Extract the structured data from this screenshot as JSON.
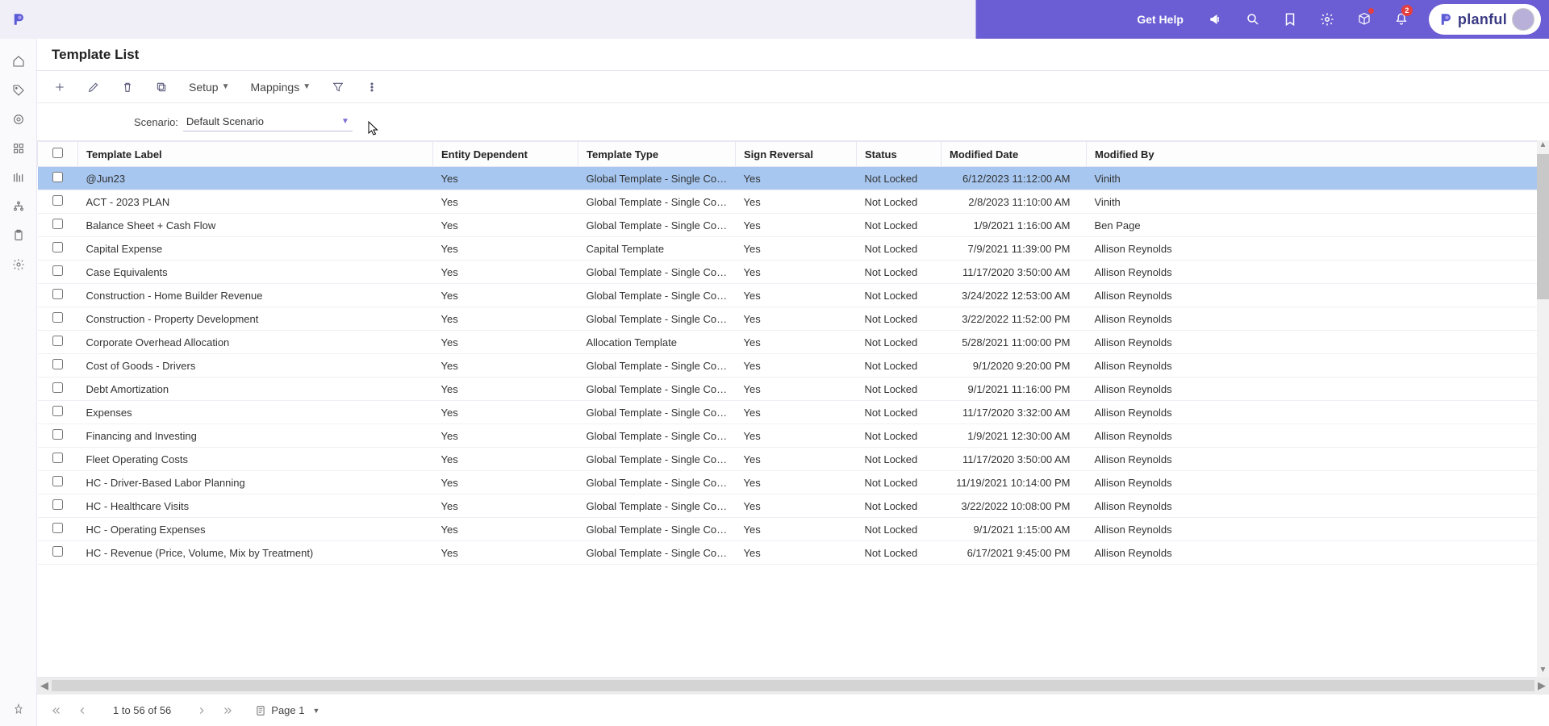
{
  "brand": {
    "name": "planful"
  },
  "header": {
    "get_help": "Get Help",
    "notification_count": "2"
  },
  "page": {
    "title": "Template List"
  },
  "toolbar": {
    "setup": "Setup",
    "mappings": "Mappings"
  },
  "scenario": {
    "label": "Scenario:",
    "value": "Default Scenario"
  },
  "columns": {
    "label": "Template Label",
    "entity": "Entity Dependent",
    "type": "Template Type",
    "sign": "Sign Reversal",
    "status": "Status",
    "date": "Modified Date",
    "by": "Modified By"
  },
  "rows": [
    {
      "label": "@Jun23",
      "entity": "Yes",
      "type": "Global Template - Single Copy",
      "sign": "Yes",
      "status": "Not Locked",
      "date": "6/12/2023 11:12:00 AM",
      "by": "Vinith",
      "selected": true
    },
    {
      "label": "ACT - 2023 PLAN",
      "entity": "Yes",
      "type": "Global Template - Single Copy",
      "sign": "Yes",
      "status": "Not Locked",
      "date": "2/8/2023 11:10:00 AM",
      "by": "Vinith"
    },
    {
      "label": "Balance Sheet + Cash Flow",
      "entity": "Yes",
      "type": "Global Template - Single Copy",
      "sign": "Yes",
      "status": "Not Locked",
      "date": "1/9/2021 1:16:00 AM",
      "by": "Ben Page"
    },
    {
      "label": "Capital Expense",
      "entity": "Yes",
      "type": "Capital Template",
      "sign": "Yes",
      "status": "Not Locked",
      "date": "7/9/2021 11:39:00 PM",
      "by": "Allison Reynolds"
    },
    {
      "label": "Case Equivalents",
      "entity": "Yes",
      "type": "Global Template - Single Copy",
      "sign": "Yes",
      "status": "Not Locked",
      "date": "11/17/2020 3:50:00 AM",
      "by": "Allison Reynolds"
    },
    {
      "label": "Construction - Home Builder Revenue",
      "entity": "Yes",
      "type": "Global Template - Single Copy",
      "sign": "Yes",
      "status": "Not Locked",
      "date": "3/24/2022 12:53:00 AM",
      "by": "Allison Reynolds"
    },
    {
      "label": "Construction - Property Development",
      "entity": "Yes",
      "type": "Global Template - Single Copy",
      "sign": "Yes",
      "status": "Not Locked",
      "date": "3/22/2022 11:52:00 PM",
      "by": "Allison Reynolds"
    },
    {
      "label": "Corporate Overhead Allocation",
      "entity": "Yes",
      "type": "Allocation Template",
      "sign": "Yes",
      "status": "Not Locked",
      "date": "5/28/2021 11:00:00 PM",
      "by": "Allison Reynolds"
    },
    {
      "label": "Cost of Goods - Drivers",
      "entity": "Yes",
      "type": "Global Template - Single Copy",
      "sign": "Yes",
      "status": "Not Locked",
      "date": "9/1/2020 9:20:00 PM",
      "by": "Allison Reynolds"
    },
    {
      "label": "Debt Amortization",
      "entity": "Yes",
      "type": "Global Template - Single Copy",
      "sign": "Yes",
      "status": "Not Locked",
      "date": "9/1/2021 11:16:00 PM",
      "by": "Allison Reynolds"
    },
    {
      "label": "Expenses",
      "entity": "Yes",
      "type": "Global Template - Single Copy",
      "sign": "Yes",
      "status": "Not Locked",
      "date": "11/17/2020 3:32:00 AM",
      "by": "Allison Reynolds"
    },
    {
      "label": "Financing and Investing",
      "entity": "Yes",
      "type": "Global Template - Single Copy",
      "sign": "Yes",
      "status": "Not Locked",
      "date": "1/9/2021 12:30:00 AM",
      "by": "Allison Reynolds"
    },
    {
      "label": "Fleet Operating Costs",
      "entity": "Yes",
      "type": "Global Template - Single Copy",
      "sign": "Yes",
      "status": "Not Locked",
      "date": "11/17/2020 3:50:00 AM",
      "by": "Allison Reynolds"
    },
    {
      "label": "HC - Driver-Based Labor Planning",
      "entity": "Yes",
      "type": "Global Template - Single Copy",
      "sign": "Yes",
      "status": "Not Locked",
      "date": "11/19/2021 10:14:00 PM",
      "by": "Allison Reynolds"
    },
    {
      "label": "HC - Healthcare Visits",
      "entity": "Yes",
      "type": "Global Template - Single Copy",
      "sign": "Yes",
      "status": "Not Locked",
      "date": "3/22/2022 10:08:00 PM",
      "by": "Allison Reynolds"
    },
    {
      "label": "HC - Operating Expenses",
      "entity": "Yes",
      "type": "Global Template - Single Copy",
      "sign": "Yes",
      "status": "Not Locked",
      "date": "9/1/2021 1:15:00 AM",
      "by": "Allison Reynolds"
    },
    {
      "label": "HC - Revenue (Price, Volume, Mix by Treatment)",
      "entity": "Yes",
      "type": "Global Template - Single Copy",
      "sign": "Yes",
      "status": "Not Locked",
      "date": "6/17/2021 9:45:00 PM",
      "by": "Allison Reynolds"
    }
  ],
  "pager": {
    "range": "1 to 56 of 56",
    "page": "Page 1"
  }
}
